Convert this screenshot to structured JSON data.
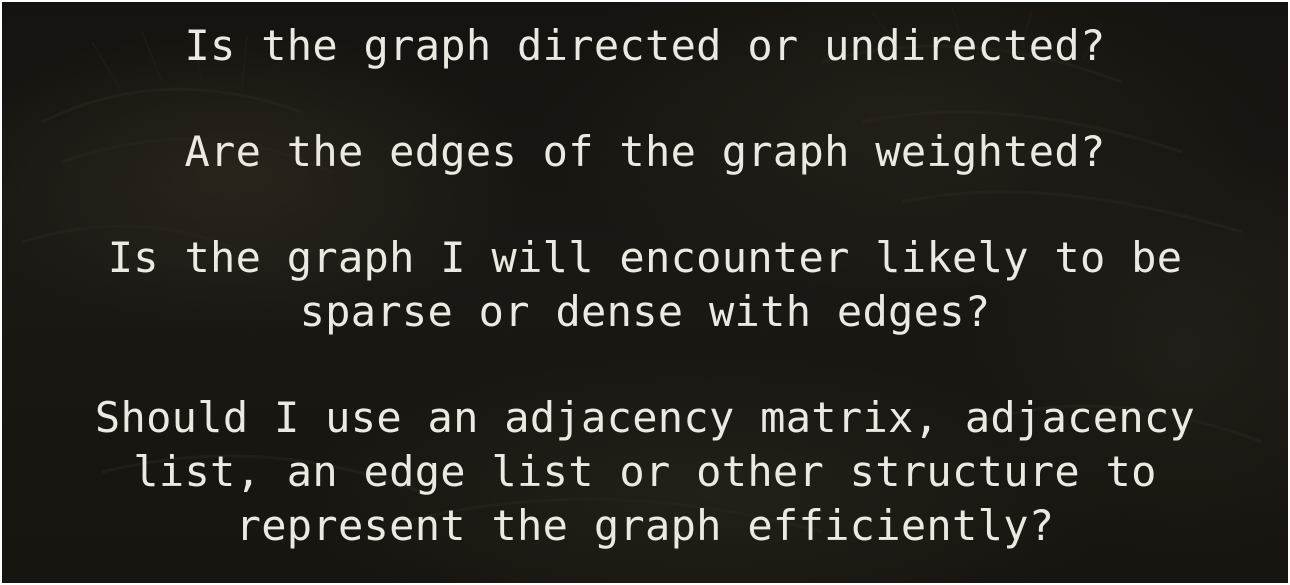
{
  "questions": [
    {
      "lines": [
        "Is the graph directed or undirected?"
      ]
    },
    {
      "lines": [
        "Are the edges of the graph weighted?"
      ]
    },
    {
      "lines": [
        "Is the graph I will encounter likely to be",
        "sparse or dense with edges?"
      ]
    },
    {
      "lines": [
        "Should I use an adjacency matrix, adjacency",
        "list, an edge list or other structure to",
        "represent the graph efficiently?"
      ]
    }
  ],
  "colors": {
    "text": "#ece9e2",
    "background": "#1a1713"
  }
}
